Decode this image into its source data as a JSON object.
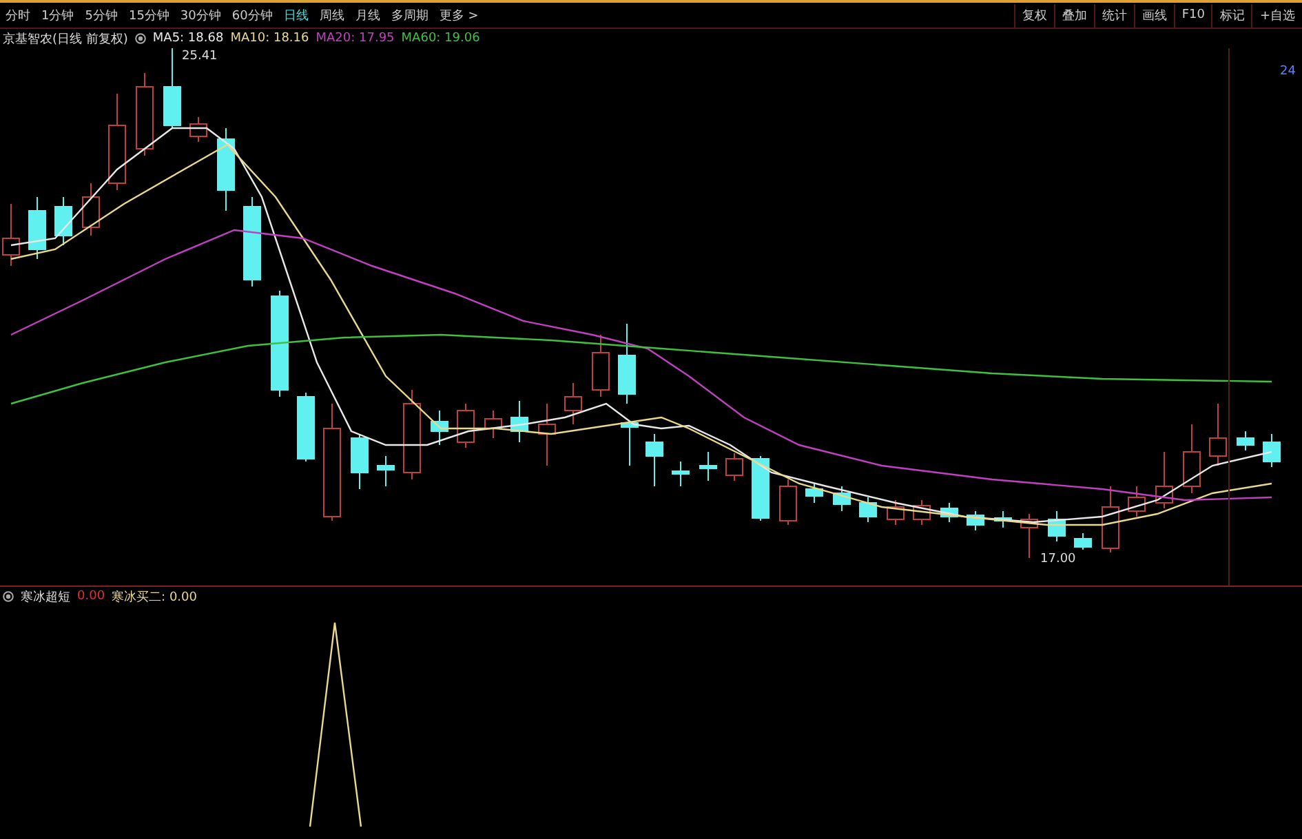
{
  "periods": [
    {
      "label": "分时",
      "selected": false
    },
    {
      "label": "1分钟",
      "selected": false
    },
    {
      "label": "5分钟",
      "selected": false
    },
    {
      "label": "15分钟",
      "selected": false
    },
    {
      "label": "30分钟",
      "selected": false
    },
    {
      "label": "60分钟",
      "selected": false
    },
    {
      "label": "日线",
      "selected": true
    },
    {
      "label": "周线",
      "selected": false
    },
    {
      "label": "月线",
      "selected": false
    },
    {
      "label": "多周期",
      "selected": false
    },
    {
      "label": "更多 >",
      "selected": false
    }
  ],
  "tools": [
    "复权",
    "叠加",
    "统计",
    "画线",
    "F10",
    "标记",
    "+自选"
  ],
  "title": "京基智农(日线 前复权)",
  "ma": [
    {
      "label": "MA5: 18.68",
      "color": "#e8e8e8"
    },
    {
      "label": "MA10: 18.16",
      "color": "#e8d890"
    },
    {
      "label": "MA20: 17.95",
      "color": "#c040c0"
    },
    {
      "label": "MA60: 19.06",
      "color": "#40c040"
    }
  ],
  "price_high": "25.41",
  "price_low": "17.00",
  "axis_label": "24",
  "indicator": {
    "name": "寒冰超短",
    "values": [
      {
        "label": "0.00",
        "color": "#e03030"
      },
      {
        "label": "寒冰买二: 0.00",
        "color": "#e8d890"
      }
    ]
  }
}
